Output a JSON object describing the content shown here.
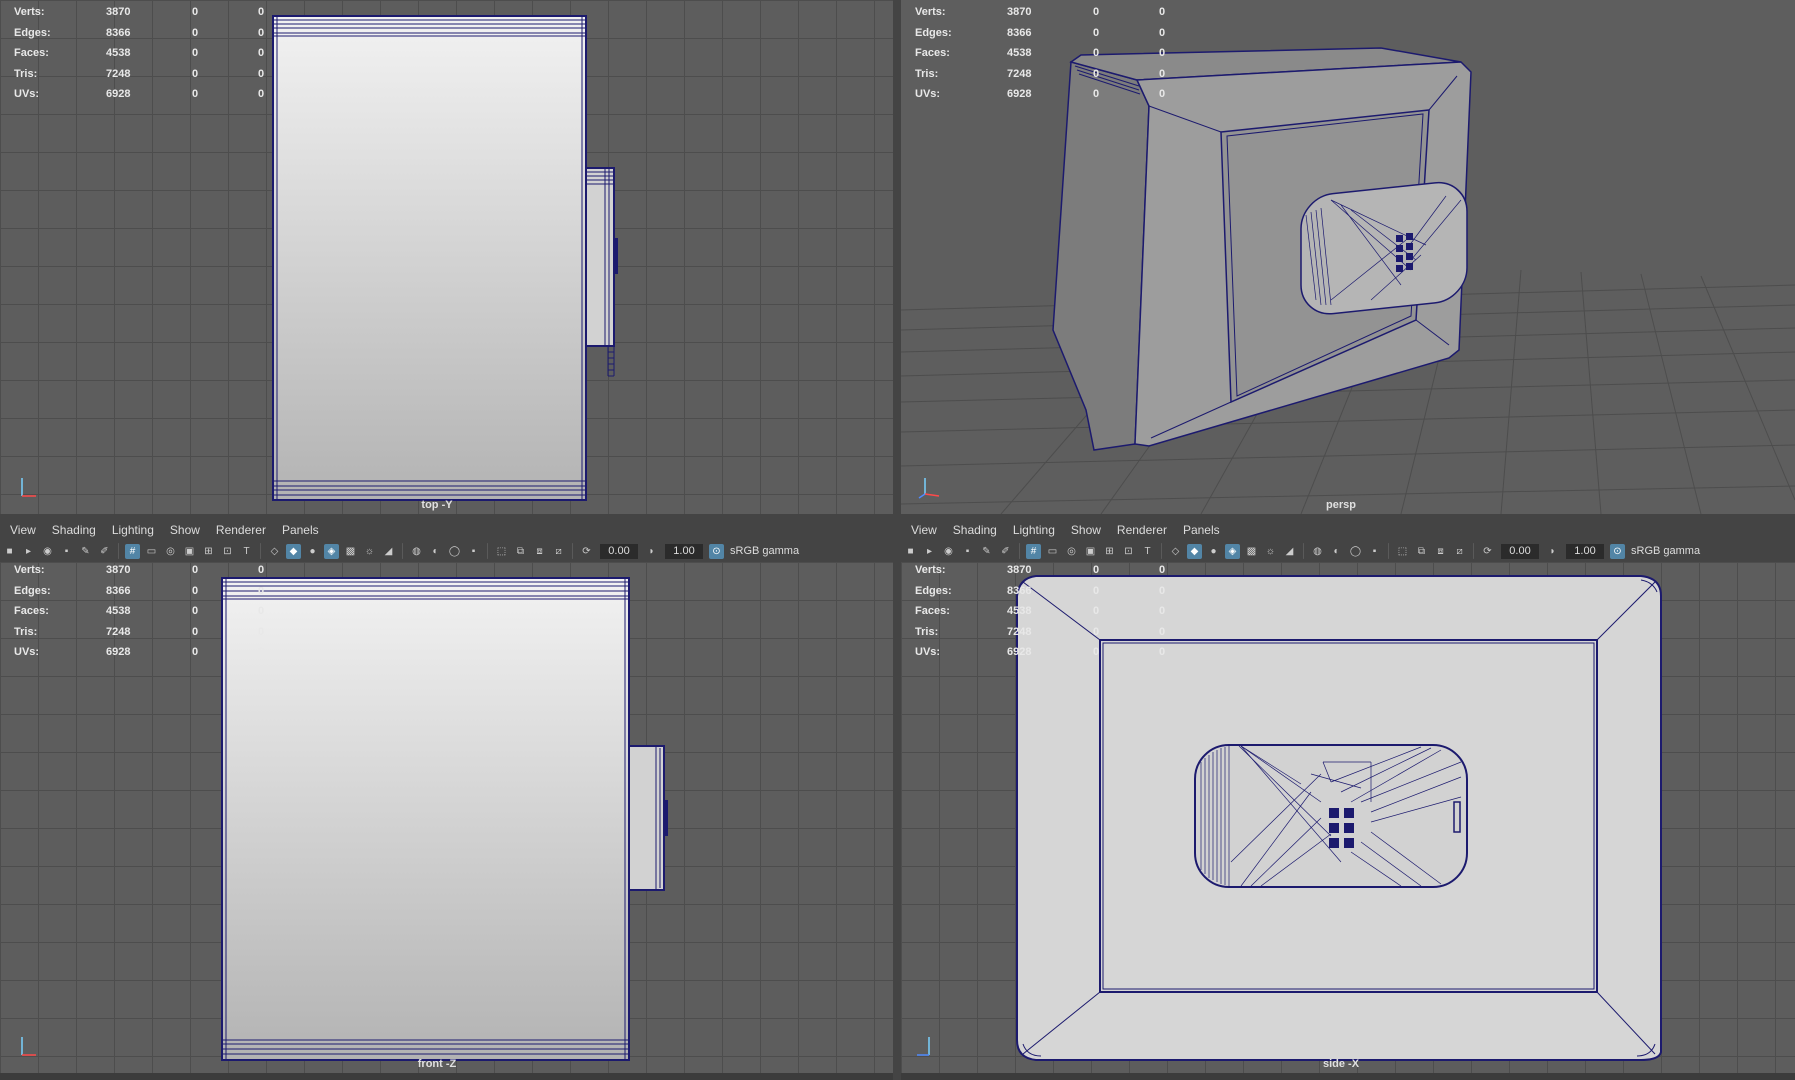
{
  "stats": [
    {
      "label": "Verts:",
      "v1": "3870",
      "v2": "0",
      "v3": "0"
    },
    {
      "label": "Edges:",
      "v1": "8366",
      "v2": "0",
      "v3": "0"
    },
    {
      "label": "Faces:",
      "v1": "4538",
      "v2": "0",
      "v3": "0"
    },
    {
      "label": "Tris:",
      "v1": "7248",
      "v2": "0",
      "v3": "0"
    },
    {
      "label": "UVs:",
      "v1": "6928",
      "v2": "0",
      "v3": "0"
    }
  ],
  "menu": {
    "view": "View",
    "shading": "Shading",
    "lighting": "Lighting",
    "show": "Show",
    "renderer": "Renderer",
    "panels": "Panels"
  },
  "toolbar": {
    "field1": "0.00",
    "field2": "1.00",
    "colorspace": "sRGB gamma"
  },
  "cameras": {
    "top": "top -Y",
    "persp": "persp",
    "front": "front -Z",
    "side": "side -X"
  },
  "colors": {
    "wire": "#1c1a6e",
    "viewport_bg": "#5d5d5d",
    "grid": "#4d4d4d",
    "accent": "#5285a6"
  }
}
